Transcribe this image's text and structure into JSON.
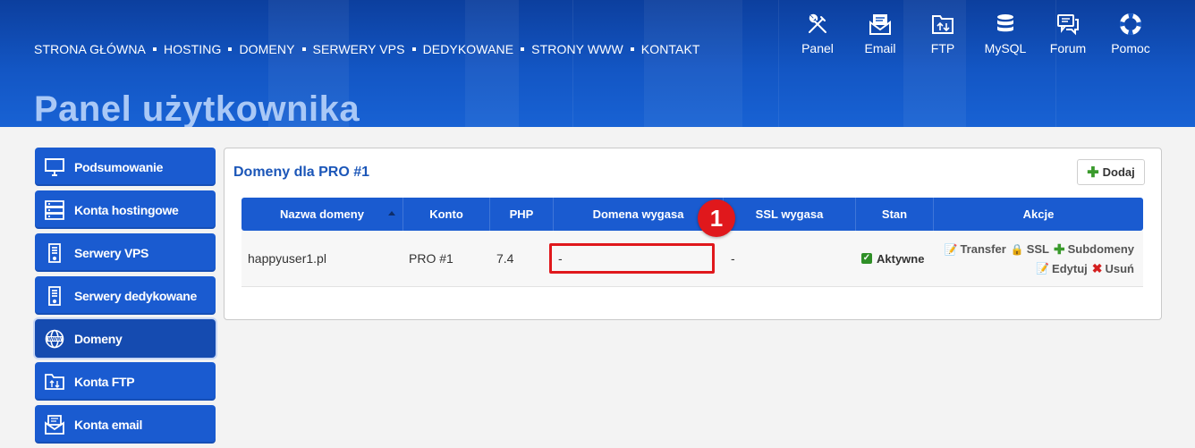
{
  "nav": {
    "links": [
      "STRONA GŁÓWNA",
      "HOSTING",
      "DOMENY",
      "SERWERY VPS",
      "DEDYKOWANE",
      "STRONY WWW",
      "KONTAKT"
    ]
  },
  "icon_nav": [
    {
      "label": "Panel",
      "icon": "tools-icon"
    },
    {
      "label": "Email",
      "icon": "email-icon"
    },
    {
      "label": "FTP",
      "icon": "ftp-folder-icon"
    },
    {
      "label": "MySQL",
      "icon": "database-icon"
    },
    {
      "label": "Forum",
      "icon": "forum-icon"
    },
    {
      "label": "Pomoc",
      "icon": "lifebuoy-icon"
    }
  ],
  "page": {
    "title": "Panel użytkownika"
  },
  "sidebar": {
    "items": [
      {
        "label": "Podsumowanie",
        "icon": "monitor-icon"
      },
      {
        "label": "Konta hostingowe",
        "icon": "server-stack-icon"
      },
      {
        "label": "Serwery VPS",
        "icon": "server-icon"
      },
      {
        "label": "Serwery dedykowane",
        "icon": "server-icon"
      },
      {
        "label": "Domeny",
        "icon": "www-globe-icon",
        "active": true
      },
      {
        "label": "Konta FTP",
        "icon": "ftp-folder-icon"
      },
      {
        "label": "Konta email",
        "icon": "email-icon"
      }
    ]
  },
  "panel": {
    "title": "Domeny dla PRO #1",
    "add_label": "Dodaj"
  },
  "table": {
    "columns": [
      "Nazwa domeny",
      "Konto",
      "PHP",
      "Domena wygasa",
      "SSL wygasa",
      "Stan",
      "Akcje"
    ],
    "rows": [
      {
        "domain": "happyuser1.pl",
        "account": "PRO #1",
        "php": "7.4",
        "domain_expires": "-",
        "ssl_expires": "-",
        "status": "Aktywne",
        "actions": {
          "transfer": "Transfer",
          "ssl": "SSL",
          "subdomains": "Subdomeny",
          "edit": "Edytuj",
          "delete": "Usuń"
        }
      }
    ]
  },
  "annotation": {
    "badge": "1"
  },
  "colors": {
    "brand_blue": "#1a5bd0",
    "header_dark": "#0c3f9e",
    "accent_red": "#e0181c",
    "title_light": "#a9c8f6"
  }
}
